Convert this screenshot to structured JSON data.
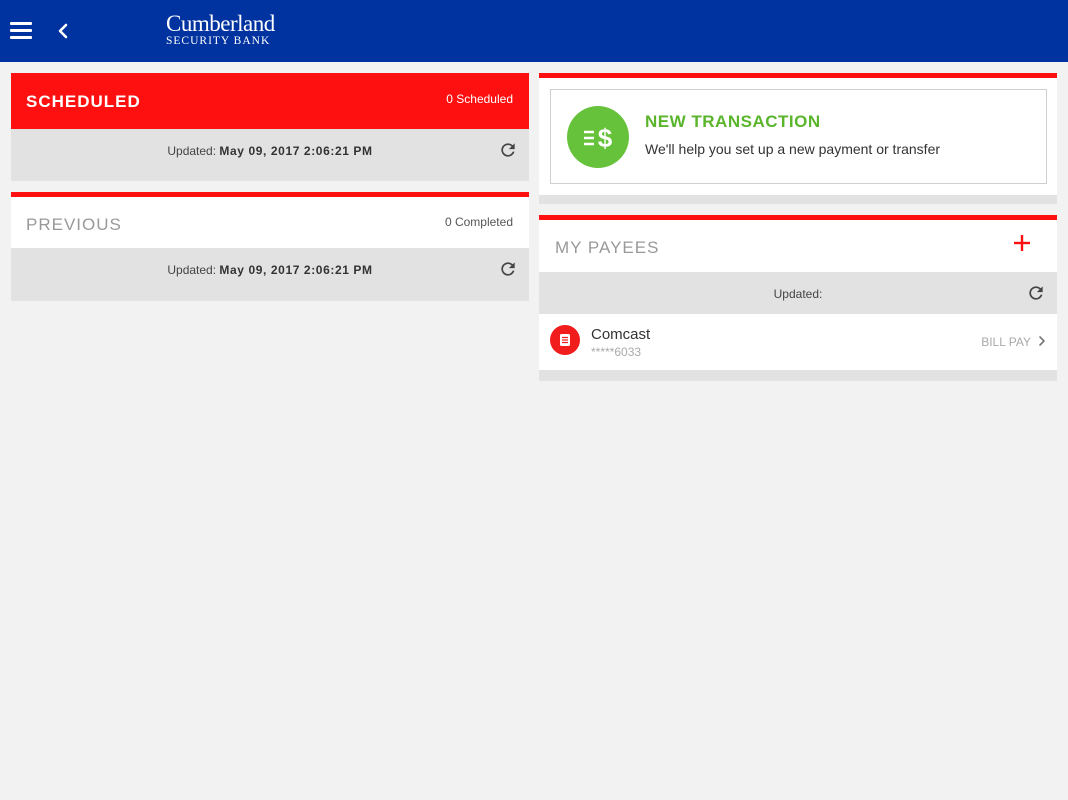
{
  "header": {
    "logo_main": "Cumberland",
    "logo_sub": "SECURITY BANK"
  },
  "scheduled": {
    "title": "SCHEDULED",
    "count": "0 Scheduled",
    "updated_label": "Updated:",
    "updated_value": "May 09, 2017 2:06:21 PM"
  },
  "previous": {
    "title": "PREVIOUS",
    "count": "0 Completed",
    "updated_label": "Updated:",
    "updated_value": "May 09, 2017 2:06:21 PM"
  },
  "new_transaction": {
    "title": "NEW TRANSACTION",
    "subtitle": "We'll help you set up a new payment or transfer"
  },
  "payees": {
    "title": "MY PAYEES",
    "updated_label": "Updated:",
    "items": [
      {
        "name": "Comcast",
        "account": "*****6033",
        "type": "BILL PAY"
      }
    ]
  },
  "colors": {
    "header_blue": "#0033a0",
    "accent_red": "#ff1010",
    "accent_green": "#66c23a"
  },
  "icons": [
    "menu-icon",
    "back-icon",
    "refresh-icon",
    "money-transfer-icon",
    "add-icon",
    "bill-icon",
    "chevron-right-icon"
  ]
}
